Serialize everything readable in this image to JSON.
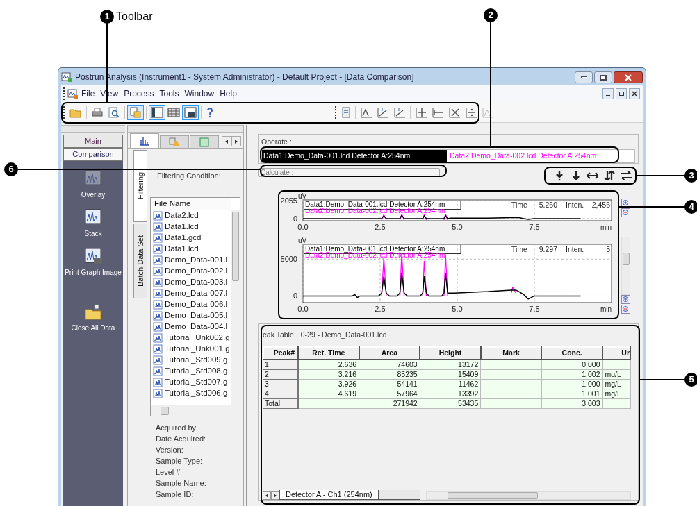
{
  "window": {
    "title": "Postrun Analysis (Instrument1 - System Administrator) - Default Project - [Data Comparison]"
  },
  "menu": [
    "File",
    "View",
    "Process",
    "Tools",
    "Window",
    "Help"
  ],
  "toolbar": {
    "left": [
      {
        "pressed": false
      },
      {
        "pressed": false
      },
      {
        "pressed": false
      },
      {
        "pressed": true
      },
      {
        "pressed": true
      },
      {
        "pressed": false
      },
      {
        "pressed": true
      },
      {
        "pressed": false
      }
    ],
    "right": [
      {
        "pressed": false
      },
      {
        "pressed": false
      },
      {
        "pressed": false
      },
      {
        "pressed": false
      },
      {
        "pressed": false
      },
      {
        "pressed": false
      },
      {
        "pressed": false
      },
      {
        "pressed": false
      },
      {
        "pressed": false,
        "disabled": true
      }
    ]
  },
  "assistant": {
    "modes": [
      {
        "label": "Main",
        "selected": false
      },
      {
        "label": "Comparison",
        "selected": true
      }
    ],
    "items": [
      {
        "label": "Overlay",
        "disabled": true
      },
      {
        "label": "Stack",
        "disabled": false
      },
      {
        "label": "Print Graph Image",
        "disabled": false
      },
      {
        "label": "Close All Data",
        "disabled": false
      }
    ]
  },
  "explorer": {
    "tabs": [
      {
        "selected": true
      },
      {
        "selected": false
      },
      {
        "selected": false
      }
    ],
    "side_tabs": [
      {
        "label": "Filtering",
        "selected": true
      },
      {
        "label": "Batch Data Set",
        "selected": false
      }
    ],
    "filter_label": "Filtering Condition:",
    "list_header": "File Name",
    "files": [
      "Data2.lcd",
      "Data1.lcd",
      "Data1.gcd",
      "Data1.lcd",
      "Demo_Data-001.l",
      "Demo_Data-002.l",
      "Demo_Data-003.l",
      "Demo_Data-007.l",
      "Demo_Data-006.l",
      "Demo_Data-005.l",
      "Demo_Data-004.l",
      "Tutorial_Unk002.g",
      "Tutorial_Unk001.g",
      "Tutorial_Std009.g",
      "Tutorial_Std008.g",
      "Tutorial_Std007.g",
      "Tutorial_Std006.g"
    ],
    "properties": [
      "Acquired by",
      "Date Acquired:",
      "Version:",
      "Sample Type:",
      "Level #",
      "Sample Name:",
      "Sample ID:"
    ]
  },
  "comparison": {
    "operate_label": "Operate :",
    "data_tabs": [
      {
        "label": "Data1:Demo_Data-001.lcd Detector A:254nm",
        "selected": true,
        "color": "#000000"
      },
      {
        "label": "Data2:Demo_Data-002.lcd Detector A:254nm",
        "selected": false,
        "color": "#ff00ff"
      }
    ],
    "calculate_placeholder": "Calculate :",
    "charts": [
      {
        "cursor": {
          "time_label": "Time",
          "time": "5.260",
          "intensity_label": "Inten.",
          "intensity": "2,456"
        },
        "chart_data": {
          "type": "line",
          "grid": true,
          "xlabel": "min",
          "ylabel": "uV",
          "xlim": [
            0,
            10
          ],
          "ylim": [
            -250,
            2150
          ],
          "xticks": [
            {
              "value": 0,
              "label": "0.0"
            },
            {
              "value": 2.5,
              "label": "2.5"
            },
            {
              "value": 5,
              "label": "5.0"
            },
            {
              "value": 7.5,
              "label": "7.5"
            }
          ],
          "yticks": [
            {
              "value": 0,
              "label": "0"
            },
            {
              "value": 2055,
              "label": "2055"
            }
          ],
          "x": [
            0,
            1.6,
            1.68,
            1.76,
            1.85,
            2.45,
            2.55,
            2.62,
            2.7,
            2.8,
            3.05,
            3.14,
            3.2,
            3.28,
            3.38,
            3.8,
            3.88,
            3.93,
            4.0,
            4.08,
            4.5,
            4.57,
            4.62,
            4.69,
            4.78,
            4.9,
            6.0,
            6.75,
            6.8,
            6.9,
            7.0,
            7.15,
            7.3,
            7.5,
            8.5,
            9.0
          ],
          "series": [
            {
              "name": "Data1:Demo_Data-001.lcd Detector A:254nm",
              "color": "#000000",
              "values": [
                0,
                0,
                0,
                0,
                0,
                0,
                0,
                300,
                0,
                0,
                0,
                0,
                350,
                0,
                0,
                0,
                0,
                300,
                0,
                0,
                0,
                0,
                350,
                0,
                50,
                50,
                50,
                100,
                100,
                100,
                100,
                0,
                -100,
                0,
                0,
                0
              ]
            },
            {
              "name": "Data2:Demo_Data-002.lcd Detector A:254nm",
              "color": "#ff00ff",
              "values": [
                null,
                null,
                null,
                null,
                null,
                null,
                -150,
                450,
                -150,
                null,
                null,
                -150,
                500,
                -150,
                null,
                null,
                -150,
                450,
                -150,
                null,
                null,
                -150,
                500,
                -150,
                null,
                null,
                null,
                null,
                null,
                null,
                null,
                null,
                null,
                null,
                null,
                null
              ]
            }
          ]
        }
      },
      {
        "cursor": {
          "time_label": "Time",
          "time": "9.297",
          "intensity_label": "Inten.",
          "intensity": "5"
        },
        "chart_data": {
          "type": "line",
          "grid": true,
          "xlabel": "min",
          "ylabel": "uV",
          "xlim": [
            0,
            10
          ],
          "ylim": [
            -900,
            7000
          ],
          "xticks": [
            {
              "value": 0,
              "label": "0.0"
            },
            {
              "value": 2.5,
              "label": "2.5"
            },
            {
              "value": 5,
              "label": "5.0"
            },
            {
              "value": 7.5,
              "label": "7.5"
            }
          ],
          "yticks": [
            {
              "value": 0,
              "label": "0"
            },
            {
              "value": 5000,
              "label": "5000"
            }
          ],
          "x": [
            0,
            1.6,
            1.68,
            1.76,
            1.85,
            2.45,
            2.55,
            2.62,
            2.7,
            2.8,
            3.05,
            3.14,
            3.2,
            3.28,
            3.38,
            3.8,
            3.88,
            3.93,
            4.0,
            4.08,
            4.5,
            4.57,
            4.62,
            4.69,
            4.78,
            4.9,
            6.0,
            6.75,
            6.8,
            6.9,
            7.0,
            7.15,
            7.3,
            7.5,
            8.5,
            9.0
          ],
          "series": [
            {
              "name": "Data1:Demo_Data-001.lcd Detector A:254nm",
              "color": "#000000",
              "values": [
                0,
                0,
                200,
                -200,
                0,
                0,
                400,
                2600,
                400,
                0,
                0,
                400,
                3100,
                400,
                0,
                0,
                400,
                2600,
                400,
                0,
                0,
                400,
                3000,
                400,
                400,
                400,
                600,
                800,
                800,
                800,
                600,
                200,
                -400,
                0,
                0,
                0
              ]
            },
            {
              "name": "Data2:Demo_Data-002.lcd Detector A:254nm",
              "color": "#ff00ff",
              "values": [
                null,
                null,
                null,
                null,
                null,
                null,
                0,
                5200,
                0,
                null,
                null,
                0,
                5800,
                0,
                null,
                null,
                0,
                4700,
                0,
                null,
                null,
                0,
                5600,
                0,
                null,
                null,
                null,
                400,
                1200,
                400,
                null,
                null,
                null,
                null,
                null,
                null
              ]
            }
          ]
        }
      }
    ]
  },
  "peak_table": {
    "title": "eak Table",
    "subtitle": "0-29 - Demo_Data-001.lcd",
    "columns": [
      "Peak#",
      "Ret. Time",
      "Area",
      "Height",
      "Mark",
      "Conc.",
      "Ur"
    ],
    "rows": [
      [
        "1",
        "2.636",
        "74603",
        "13172",
        null,
        "0.000",
        null
      ],
      [
        "2",
        "3.216",
        "85235",
        "15409",
        null,
        "1.002",
        "mg/L"
      ],
      [
        "3",
        "3.926",
        "54141",
        "11462",
        null,
        "1.000",
        "mg/L"
      ],
      [
        "4",
        "4.619",
        "57964",
        "13392",
        null,
        "1.001",
        "mg/L"
      ],
      [
        "Total",
        null,
        "271942",
        "53435",
        null,
        "3.003",
        null
      ]
    ],
    "sheet_tabs": [
      {
        "label": "Detector A - Ch1 (254nm)",
        "selected": true
      },
      {
        "selected": false
      }
    ]
  },
  "callouts": [
    {
      "number": "1",
      "label": "Toolbar"
    },
    {
      "number": "2"
    },
    {
      "number": "3"
    },
    {
      "number": "4"
    },
    {
      "number": "5"
    },
    {
      "number": "6"
    }
  ]
}
